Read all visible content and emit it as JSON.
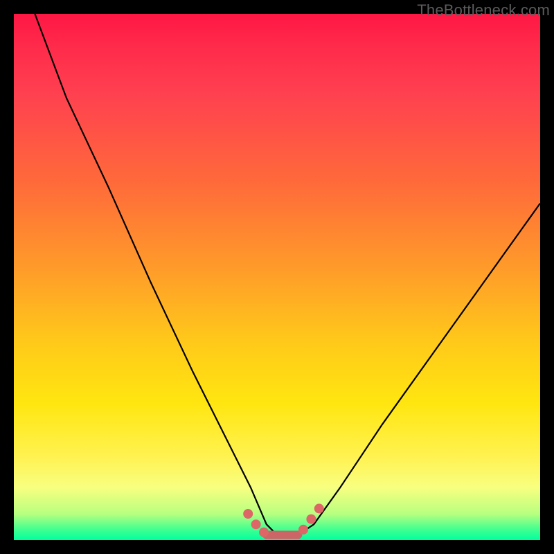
{
  "watermark": "TheBottleneck.com",
  "chart_data": {
    "type": "line",
    "title": "",
    "xlabel": "",
    "ylabel": "",
    "xlim": [
      0,
      100
    ],
    "ylim": [
      0,
      100
    ],
    "series": [
      {
        "name": "curve",
        "x": [
          4,
          10,
          18,
          26,
          34,
          40,
          45,
          48,
          50,
          52,
          54,
          57,
          62,
          70,
          80,
          90,
          100
        ],
        "values": [
          100,
          84,
          67,
          49,
          32,
          20,
          10,
          3,
          1,
          1,
          1,
          3,
          10,
          22,
          36,
          50,
          64
        ],
        "color": "#000000"
      }
    ],
    "markers": [
      {
        "name": "dot",
        "x": 44.5,
        "y": 5.0,
        "color": "#d66"
      },
      {
        "name": "dot",
        "x": 46.0,
        "y": 3.0,
        "color": "#d66"
      },
      {
        "name": "dot",
        "x": 47.5,
        "y": 1.5,
        "color": "#d66"
      },
      {
        "name": "dot",
        "x": 55.0,
        "y": 2.0,
        "color": "#d66"
      },
      {
        "name": "dot",
        "x": 56.5,
        "y": 4.0,
        "color": "#d66"
      },
      {
        "name": "dot",
        "x": 58.0,
        "y": 6.0,
        "color": "#d66"
      }
    ],
    "flat_segment": {
      "x0": 48.0,
      "x1": 54.0,
      "y": 1.0,
      "color": "#d66"
    },
    "grid": false,
    "legend": false
  }
}
